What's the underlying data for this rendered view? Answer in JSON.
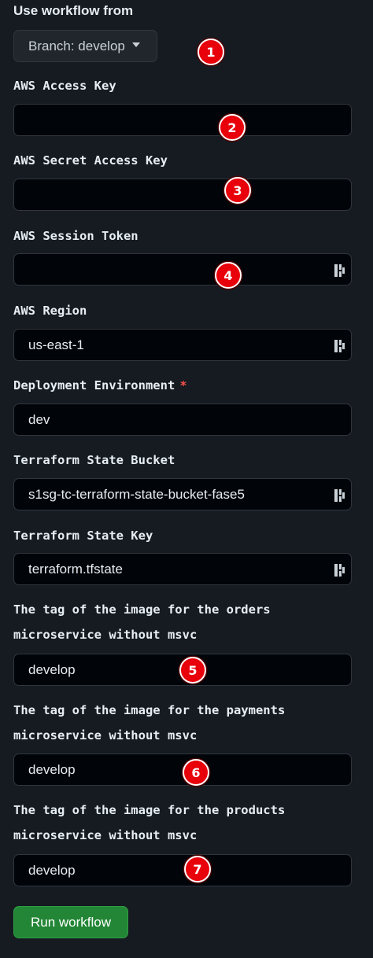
{
  "workflow": {
    "heading": "Use workflow from",
    "branch_label": "Branch: develop"
  },
  "fields": [
    {
      "label": "AWS Access Key",
      "value": "",
      "badge": "1"
    },
    {
      "label": "AWS Secret Access Key",
      "value": "",
      "badge": "2"
    },
    {
      "label": "AWS Session Token",
      "value": "",
      "badge": "3"
    },
    {
      "label": "AWS Region",
      "value": "us-east-1",
      "badge": "4"
    },
    {
      "label": "Deployment Environment",
      "required_marker": "*",
      "value": "dev"
    },
    {
      "label": "Terraform State Bucket",
      "value": "s1sg-tc-terraform-state-bucket-fase5"
    },
    {
      "label": "Terraform State Key",
      "value": "terraform.tfstate"
    },
    {
      "label_line1": "The tag of the image for the orders",
      "label_line2": "microservice without msvc",
      "value": "develop",
      "badge": "5"
    },
    {
      "label_line1": "The tag of the image for the payments",
      "label_line2": "microservice without msvc",
      "value": "develop",
      "badge": "6"
    },
    {
      "label_line1": "The tag of the image for the products",
      "label_line2": "microservice without msvc",
      "value": "develop",
      "badge": "7"
    }
  ],
  "badges": [
    "1",
    "2",
    "3",
    "4",
    "5",
    "6",
    "7"
  ],
  "run_button": {
    "label": "Run workflow"
  },
  "icons": {
    "caret": "caret-down-icon",
    "password_manager": "password-manager-key-icon"
  },
  "colors": {
    "background": "#161b22",
    "input_background": "#010409",
    "run_button": "#238636",
    "badge": "#e8000b",
    "required": "#f85149"
  }
}
